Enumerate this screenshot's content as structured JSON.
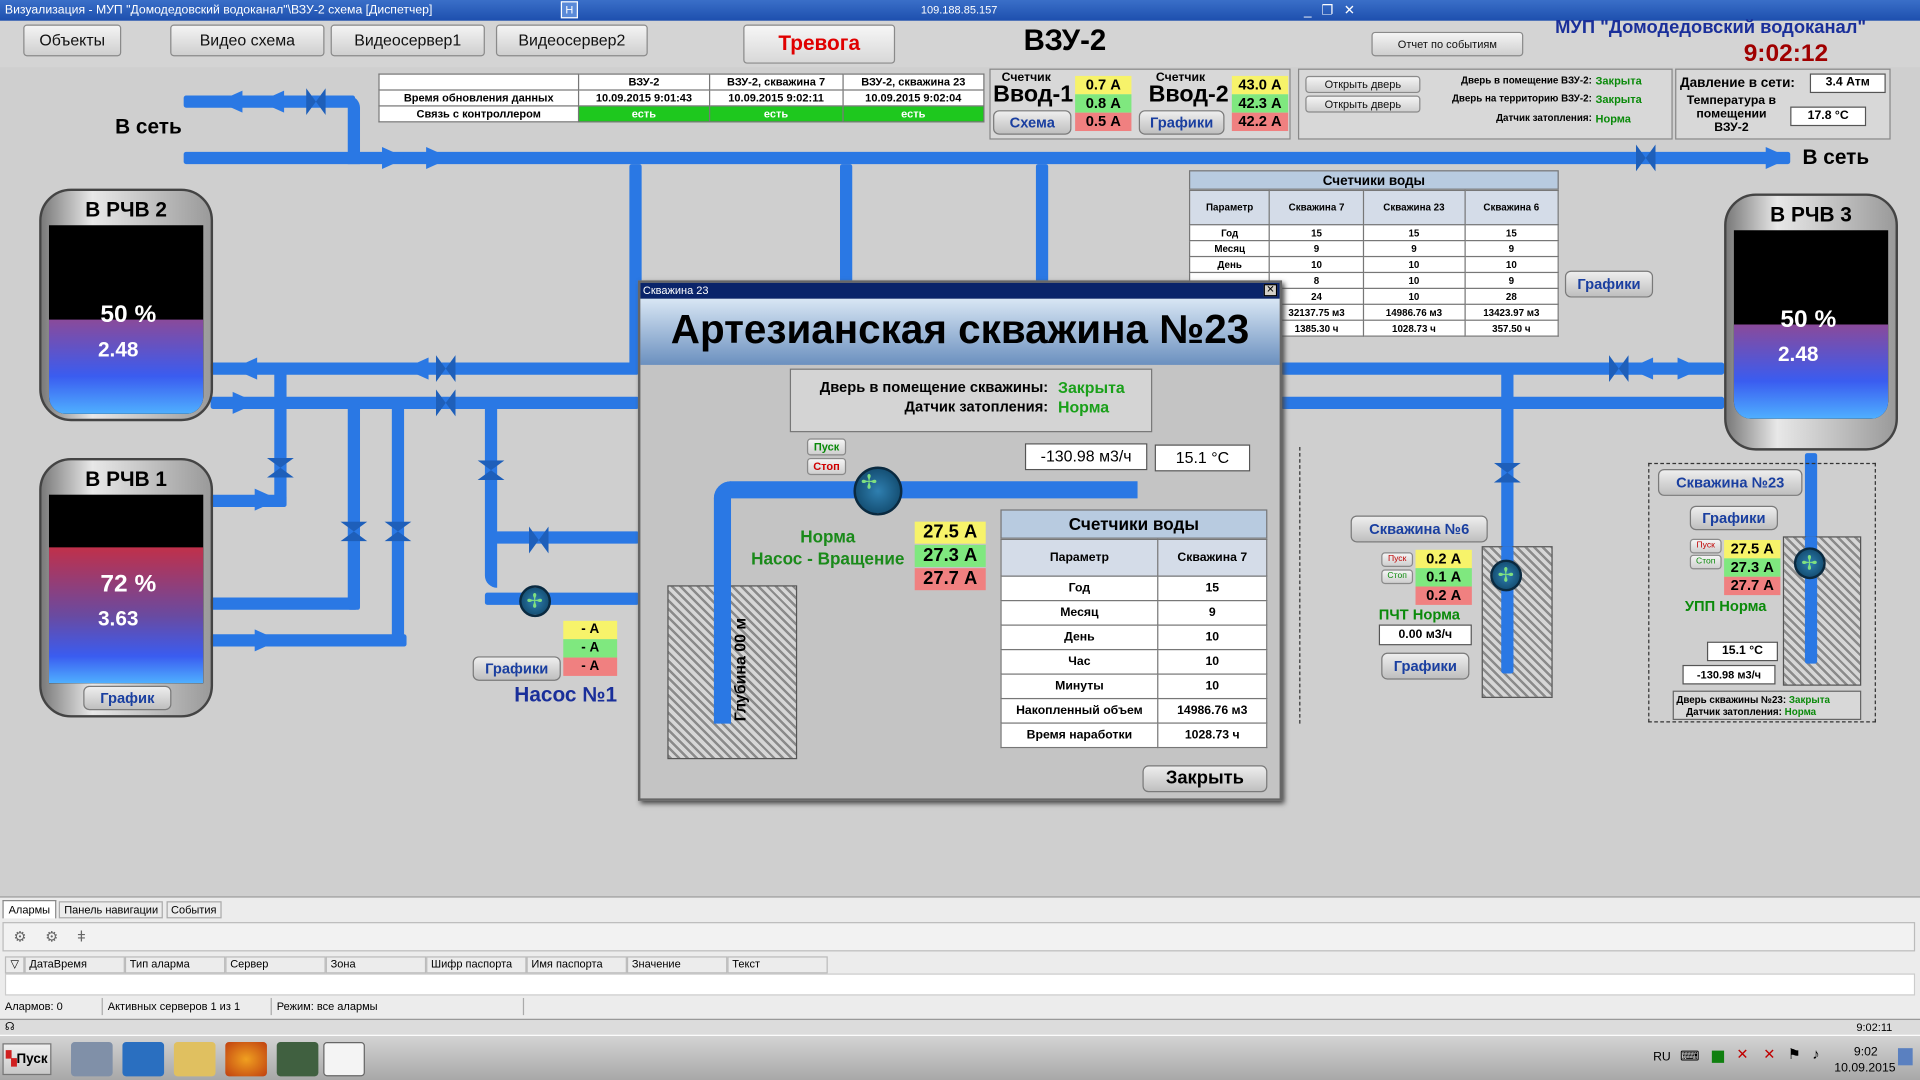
{
  "window": {
    "title": "Визуализация - МУП \"Домодедовский водоканал\"\\ВЗУ-2 схема [Диспетчер]",
    "remote_ip": "109.188.85.157",
    "controls": [
      "_",
      "❐",
      "✕"
    ],
    "restore_icon": "H"
  },
  "nav": {
    "objects": "Объекты",
    "video_scheme": "Видео схема",
    "video_server1": "Видеосервер1",
    "video_server2": "Видеосервер2",
    "alarm": "Тревога",
    "station": "ВЗУ-2",
    "events_report": "Отчет по событиям"
  },
  "org": {
    "name": "МУП \"Домодедовский водоканал\"",
    "clock": "9:02:12"
  },
  "status_table": {
    "headers": [
      "",
      "ВЗУ-2",
      "ВЗУ-2, скважина 7",
      "ВЗУ-2, скважина 23"
    ],
    "rows": [
      [
        "Время обновления данных",
        "10.09.2015 9:01:43",
        "10.09.2015 9:02:11",
        "10.09.2015 9:02:04"
      ],
      [
        "Связь с контроллером",
        "есть",
        "есть",
        "есть"
      ]
    ]
  },
  "counters": {
    "input1": {
      "caption": "Счетчик",
      "name": "Ввод-1",
      "amps": [
        "0.7 А",
        "0.8 А",
        "0.5 А"
      ],
      "button": "Схема"
    },
    "input2": {
      "caption": "Счетчик",
      "name": "Ввод-2",
      "amps": [
        "43.0 А",
        "42.3 А",
        "42.2 А"
      ],
      "button": "Графики"
    }
  },
  "doors": {
    "open_door": "Открыть дверь",
    "rows": [
      {
        "label": "Дверь в помещение ВЗУ-2:",
        "value": "Закрыта"
      },
      {
        "label": "Дверь на территорию ВЗУ-2:",
        "value": "Закрыта"
      },
      {
        "label": "Датчик затопления:",
        "value": "Норма"
      }
    ]
  },
  "pressure": {
    "label": "Давление в сети:",
    "value": "3.4 Атм",
    "temp_label": "Температура в помещении ВЗУ-2",
    "temp_value": "17.8 °С"
  },
  "scheme": {
    "to_network": "В сеть",
    "pump1": "Насос №1",
    "pump1_amps": [
      "- А",
      "- А",
      "- А"
    ],
    "graphs": "Графики",
    "graph": "График"
  },
  "tanks": [
    {
      "name": "В РЧВ 2",
      "level": 50,
      "percent": "50 %",
      "value": "2.48"
    },
    {
      "name": "В РЧВ 1",
      "level": 72,
      "percent": "72 %",
      "value": "3.63"
    },
    {
      "name": "В РЧВ 3",
      "level": 50,
      "percent": "50 %",
      "value": "2.48"
    }
  ],
  "meters_table": {
    "title": "Счетчики воды",
    "headers": [
      "Параметр",
      "Скважина 7",
      "Скважина 23",
      "Скважина 6"
    ],
    "rows": [
      [
        "Год",
        "15",
        "15",
        "15"
      ],
      [
        "Месяц",
        "9",
        "9",
        "9"
      ],
      [
        "День",
        "10",
        "10",
        "10"
      ],
      [
        "",
        "8",
        "10",
        "9"
      ],
      [
        "",
        "24",
        "10",
        "28"
      ],
      [
        "",
        "32137.75 м3",
        "14986.76 м3",
        "13423.97 м3"
      ],
      [
        "и",
        "1385.30 ч",
        "1028.73 ч",
        "357.50 ч"
      ]
    ]
  },
  "well6": {
    "name": "Скважина №6",
    "amps": [
      "0.2 А",
      "0.1 А",
      "0.2 А"
    ],
    "start": "Пуск",
    "stop": "Стоп",
    "status": "ПЧТ Норма",
    "flow": "0.00 м3/ч",
    "graphs": "Графики"
  },
  "well23": {
    "name": "Скважина №23",
    "graphs": "Графики",
    "amps": [
      "27.5 А",
      "27.3 А",
      "27.7 А"
    ],
    "start": "Пуск",
    "stop": "Стоп",
    "status": "УПП Норма",
    "temp": "15.1 °С",
    "flow": "-130.98 м3/ч",
    "door_label": "Дверь скважины №23:",
    "door_value": "Закрыта",
    "flood_label": "Датчик затопления:",
    "flood_value": "Норма"
  },
  "popup": {
    "window_title": "Скважина 23",
    "title": "Артезианская скважина №23",
    "door_label": "Дверь в помещение скважины:",
    "door_value": "Закрыта",
    "flood_label": "Датчик затопления:",
    "flood_value": "Норма",
    "start": "Пуск",
    "stop": "Стоп",
    "flow": "-130.98 м3/ч",
    "temp": "15.1 °С",
    "status1": "Норма",
    "status2": "Насос - Вращение",
    "amps": [
      "27.5 А",
      "27.3 А",
      "27.7 А"
    ],
    "depth": "Глубина 00 м",
    "close": "Закрыть",
    "meters": {
      "title": "Счетчики воды",
      "headers": [
        "Параметр",
        "Скважина 7"
      ],
      "rows": [
        [
          "Год",
          "15"
        ],
        [
          "Месяц",
          "9"
        ],
        [
          "День",
          "10"
        ],
        [
          "Час",
          "10"
        ],
        [
          "Минуты",
          "10"
        ],
        [
          "Накопленный объем",
          "14986.76 м3"
        ],
        [
          "Время наработки",
          "1028.73 ч"
        ]
      ]
    }
  },
  "bottom": {
    "tabs": [
      "Алармы",
      "Панель навигации",
      "События"
    ],
    "columns": [
      "ДатаВремя",
      "Тип аларма",
      "Сервер",
      "Зона",
      "Шифр паспорта",
      "Имя паспорта",
      "Значение",
      "Текст"
    ],
    "status": [
      "Алармов: 0",
      "Активных серверов 1 из 1",
      "Режим: все алармы"
    ],
    "time": "9:02:11"
  },
  "taskbar": {
    "start": "Пуск",
    "lang": "RU",
    "time": "9:02",
    "date": "10.09.2015"
  },
  "colors": {
    "pipe": "#2a78e4",
    "accent_red": "#c00000",
    "ok_green": "#1ec81e"
  }
}
